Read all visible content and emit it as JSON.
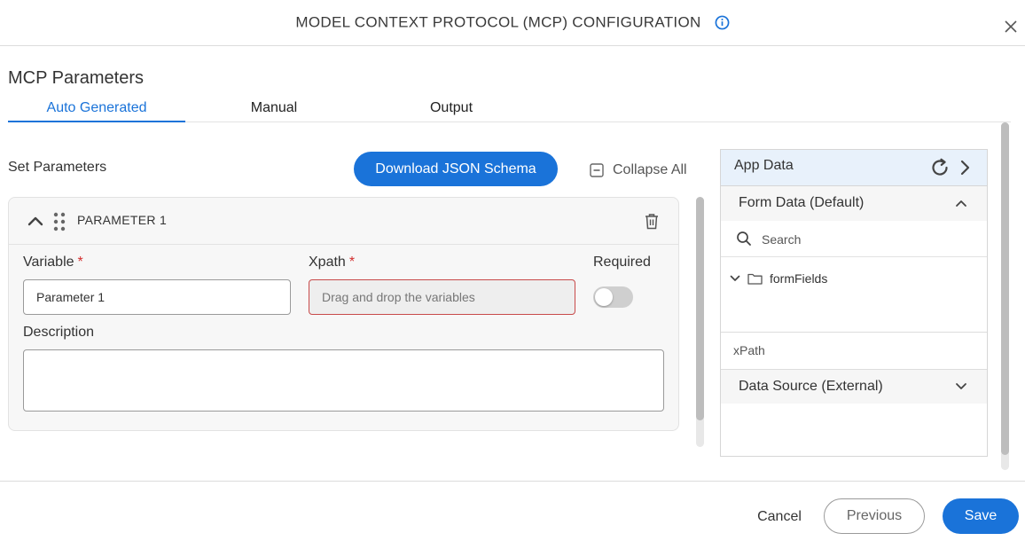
{
  "header": {
    "title": "MODEL CONTEXT PROTOCOL (MCP) CONFIGURATION",
    "info_icon": "info-icon",
    "close_icon": "close-icon"
  },
  "page_title": "MCP Parameters",
  "tabs": [
    {
      "label": "Auto Generated",
      "active": true
    },
    {
      "label": "Manual",
      "active": false
    },
    {
      "label": "Output",
      "active": false
    }
  ],
  "set_parameters_label": "Set Parameters",
  "download_button": "Download JSON Schema",
  "collapse_all": "Collapse All",
  "parameter": {
    "name": "PARAMETER 1",
    "variable_label": "Variable",
    "variable_value": "Parameter 1",
    "xpath_label": "Xpath",
    "xpath_placeholder": "Drag and drop the variables",
    "required_label": "Required",
    "required_marker": "*",
    "required_on": false,
    "description_label": "Description",
    "description_value": ""
  },
  "app_data": {
    "title": "App Data",
    "form_data": {
      "title": "Form Data (Default)",
      "expanded": true
    },
    "search_placeholder": "Search",
    "tree": [
      {
        "label": "formFields",
        "type": "folder",
        "expanded": true
      }
    ],
    "xpath_label": "xPath",
    "data_source": {
      "title": "Data Source (External)",
      "expanded": false
    }
  },
  "footer": {
    "cancel": "Cancel",
    "previous": "Previous",
    "save": "Save"
  },
  "colors": {
    "accent": "#1a73d9",
    "required": "#d32f2f",
    "error_border": "#c84a4a",
    "panel_header": "#e8f1fb"
  }
}
